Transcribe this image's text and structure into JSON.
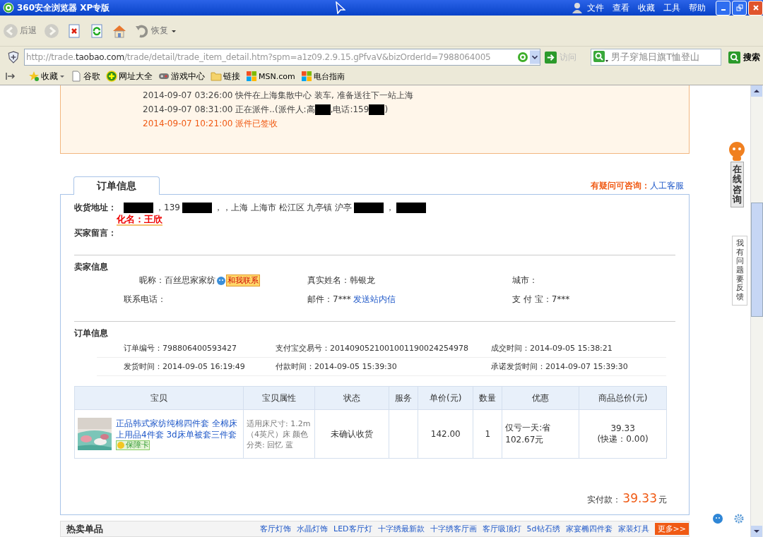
{
  "browser": {
    "title": "360安全浏览器 XP专版",
    "menu": [
      "文件",
      "查看",
      "收藏",
      "工具",
      "帮助"
    ],
    "toolbar": [
      {
        "kind": "back",
        "label": "后退",
        "disabled": true
      },
      {
        "kind": "forward",
        "disabled": true
      },
      {
        "kind": "stop",
        "disabled": false
      },
      {
        "kind": "refresh",
        "disabled": false
      },
      {
        "kind": "home",
        "disabled": false
      },
      {
        "kind": "restore",
        "label": "恢复",
        "disabled": true
      }
    ],
    "url_prefix": "http://trade.",
    "url_domain": "taobao.com",
    "url_rest": "/trade/detail/trade_item_detail.htm?spm=a1z09.2.9.15.gPfvaV&bizOrderId=7988064005",
    "go_label": "访问",
    "search_value": "男子穿旭日旗T恤登山",
    "search_button": "搜索",
    "bookmarks": [
      {
        "kind": "star",
        "label": "收藏"
      },
      {
        "kind": "page",
        "label": "谷歌"
      },
      {
        "kind": "plus",
        "label": "网址大全"
      },
      {
        "kind": "gamepad",
        "label": "游戏中心"
      },
      {
        "kind": "folder",
        "label": "链接"
      },
      {
        "kind": "windows",
        "label": "MSN.com"
      },
      {
        "kind": "windows",
        "label": "电台指南"
      }
    ]
  },
  "logistics": {
    "events": [
      {
        "latest": false,
        "parts": [
          {
            "kind": "text",
            "text": "2014-09-07 03:26:00 快件在上海集散中心 装车, 准备送往下一站上海"
          }
        ]
      },
      {
        "latest": false,
        "parts": [
          {
            "kind": "text",
            "text": "2014-09-07 08:31:00 正在派件..(派件人:高"
          },
          {
            "kind": "redacted"
          },
          {
            "kind": "text",
            "text": ",电话:159"
          },
          {
            "kind": "redacted"
          },
          {
            "kind": "text",
            "text": ")"
          }
        ]
      },
      {
        "latest": true,
        "parts": [
          {
            "kind": "text",
            "text": "2014-09-07 10:21:00 派件已签收"
          }
        ]
      }
    ]
  },
  "order": {
    "tab": {
      "label": "订单信息",
      "selected": true
    },
    "consult_label": "有疑问可咨询：",
    "consult_link": "人工客服",
    "address_label": "收货地址：",
    "address_parts": [
      {
        "kind": "redacted"
      },
      {
        "kind": "text",
        "text": "，139"
      },
      {
        "kind": "redacted"
      },
      {
        "kind": "text",
        "text": "，，上海 上海市 松江区 九亭镇 沪亭"
      },
      {
        "kind": "redacted"
      },
      {
        "kind": "text",
        "text": "，"
      },
      {
        "kind": "redacted"
      }
    ],
    "annotation": "化名：王欣",
    "message_label": "买家留言：",
    "seller": {
      "title": "卖家信息",
      "nick_label": "昵称：",
      "nick": "百丝思家家纺",
      "contact": "和我联系",
      "realname": "真实姓名：韩银龙",
      "city": "城市：",
      "phone": "联系电话：",
      "mail": "邮件：7***",
      "mail_link": "发送站内信",
      "alipay": "支 付 宝：7***"
    },
    "info": {
      "title": "订单信息",
      "rows": [
        [
          "订单编号：798806400593427",
          "支付宝交易号：2014090521001001190024254978",
          "成交时间：2014-09-05 15:38:21"
        ],
        [
          "发货时间：2014-09-05 16:19:49",
          "付款时间：2014-09-05 15:39:30",
          "承诺发货时间：2014-09-07 15:39:30"
        ]
      ]
    },
    "table": {
      "columns": [
        "宝贝",
        "宝贝属性",
        "状态",
        "服务",
        "单价(元)",
        "数量",
        "优惠",
        "商品总价(元)"
      ],
      "rows": [
        {
          "title": "正品韩式家纺纯棉四件套 全棉床上用品4件套 3d床单被套三件套",
          "badge": "保障卡",
          "attributes": "适用床尺寸: 1.2m（4英尺）床 颜色分类: 回忆 蓝",
          "status": "未确认收货",
          "price": "142.00",
          "quantity": "1",
          "discount": "仅亏一天:省102.67元",
          "total": "39.33",
          "shipping": "(快递：0.00)"
        }
      ]
    },
    "paid_label": "实付款：",
    "paid_amount": "39.33",
    "paid_unit": "元"
  },
  "hot": {
    "title": "热卖单品",
    "links": [
      "客厅灯饰",
      "水晶灯饰",
      "LED客厅灯",
      "十字绣最新款",
      "十字绣客厅画",
      "客厅吸顶灯",
      "5d钻石绣",
      "家宴椭四件套",
      "家装灯具"
    ],
    "more": "更多>>"
  },
  "side": {
    "consult": "在线咨询",
    "feedback": "我有问题要反馈"
  }
}
